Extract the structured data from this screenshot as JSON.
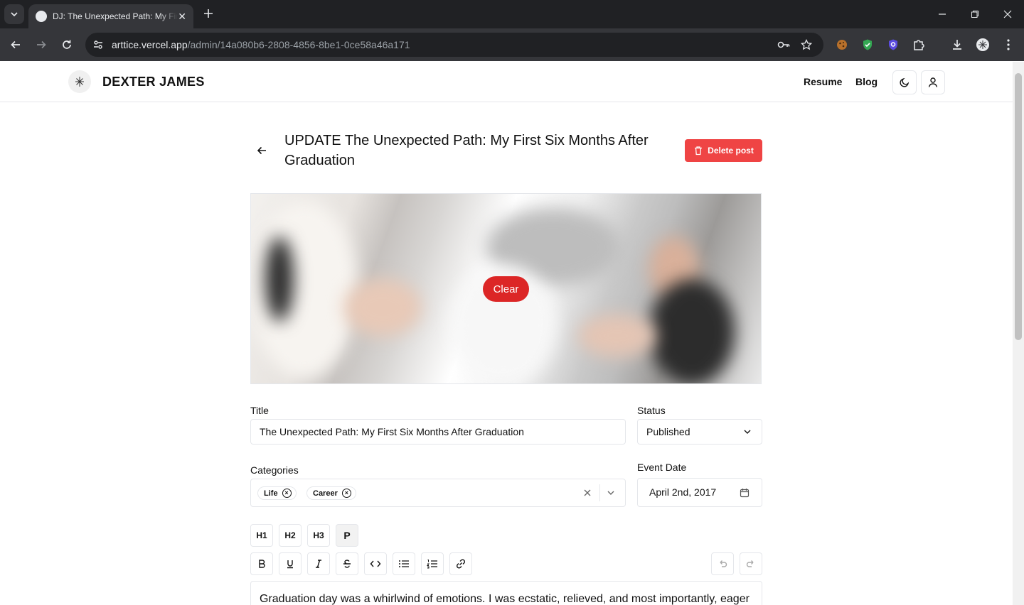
{
  "browser": {
    "tab_title": "DJ: The Unexpected Path: My First Six Months After Graduation",
    "url_host": "arttice.vercel.app",
    "url_path": "/admin/14a080b6-2808-4856-8be1-0ce58a46a171"
  },
  "header": {
    "brand": "DEXTER JAMES",
    "nav": [
      "Resume",
      "Blog"
    ]
  },
  "post": {
    "heading": "UPDATE The Unexpected Path: My First Six Months After Graduation",
    "delete_label": "Delete post",
    "clear_label": "Clear"
  },
  "form": {
    "title_label": "Title",
    "title_value": "The Unexpected Path: My First Six Months After Graduation",
    "status_label": "Status",
    "status_value": "Published",
    "categories_label": "Categories",
    "categories": [
      "Life",
      "Career"
    ],
    "event_date_label": "Event Date",
    "event_date_value": "April 2nd, 2017"
  },
  "toolbar": {
    "headings": [
      "H1",
      "H2",
      "H3",
      "P"
    ]
  },
  "editor": {
    "content": "Graduation day was a whirlwind of emotions. I was ecstatic, relieved, and most importantly, eager"
  },
  "colors": {
    "accent_red": "#ef4444",
    "clear_red": "#dc2626",
    "chrome_dark": "#202124"
  }
}
